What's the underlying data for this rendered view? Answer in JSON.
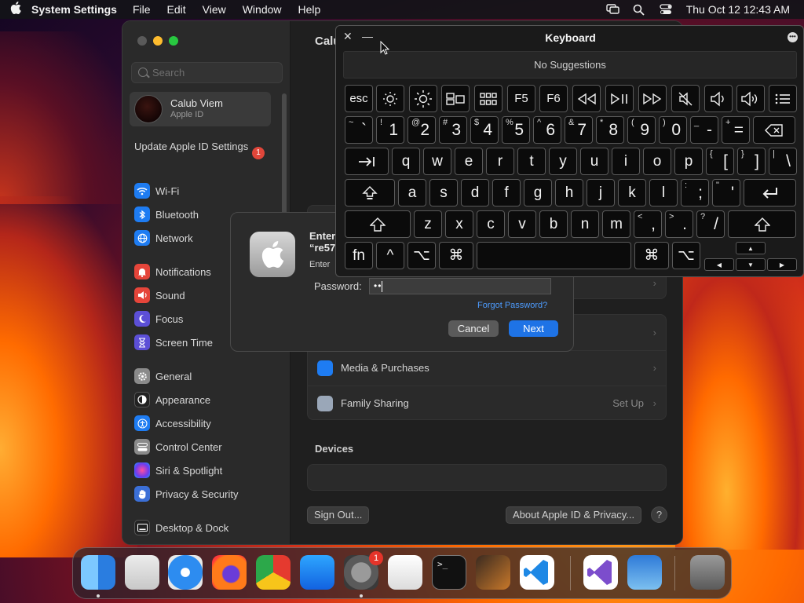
{
  "menubar": {
    "app_name": "System Settings",
    "menus": [
      "File",
      "Edit",
      "View",
      "Window",
      "Help"
    ],
    "clock": "Thu Oct 12  12:43 AM"
  },
  "sidebar": {
    "search_placeholder": "Search",
    "account": {
      "name": "Calub Viem",
      "subtitle": "Apple ID"
    },
    "update": {
      "label": "Update Apple ID Settings",
      "badge": "1"
    },
    "items": [
      {
        "label": "Wi-Fi",
        "icon": "wifi-icon",
        "color": "#1e7cf2"
      },
      {
        "label": "Bluetooth",
        "icon": "bluetooth-icon",
        "color": "#1e7cf2"
      },
      {
        "label": "Network",
        "icon": "globe-icon",
        "color": "#1e7cf2"
      },
      {
        "label": "Notifications",
        "icon": "bell-icon",
        "color": "#e5453a"
      },
      {
        "label": "Sound",
        "icon": "speaker-icon",
        "color": "#e5453a"
      },
      {
        "label": "Focus",
        "icon": "moon-icon",
        "color": "#5c4fd6"
      },
      {
        "label": "Screen Time",
        "icon": "hourglass-icon",
        "color": "#5c4fd6"
      },
      {
        "label": "General",
        "icon": "gear-icon",
        "color": "#8a8a8a"
      },
      {
        "label": "Appearance",
        "icon": "appearance-icon",
        "color": "#222222"
      },
      {
        "label": "Accessibility",
        "icon": "accessibility-icon",
        "color": "#1e7cf2"
      },
      {
        "label": "Control Center",
        "icon": "control-center-icon",
        "color": "#8a8a8a"
      },
      {
        "label": "Siri & Spotlight",
        "icon": "siri-icon",
        "color": "#b04ad8"
      },
      {
        "label": "Privacy & Security",
        "icon": "hand-icon",
        "color": "#3b6fd6"
      },
      {
        "label": "Desktop & Dock",
        "icon": "dock-icon",
        "color": "#222222"
      }
    ]
  },
  "content": {
    "title": "Calub Viem",
    "rows": [
      {
        "label": "Media & Purchases",
        "icon": "app-store-icon",
        "value": ""
      },
      {
        "label": "Family Sharing",
        "icon": "family-icon",
        "value": "Set Up"
      }
    ],
    "devices_title": "Devices",
    "sign_out": "Sign Out...",
    "about": "About Apple ID & Privacy...",
    "help": "?"
  },
  "dialog": {
    "title_line1": "Enter",
    "title_line2": "“re57",
    "subtitle": "Enter",
    "password_label": "Password:",
    "password_value": "••",
    "forgot": "Forgot Password?",
    "cancel": "Cancel",
    "next": "Next"
  },
  "keyboard": {
    "title": "Keyboard",
    "suggestions": "No Suggestions",
    "row_fn": [
      "esc",
      "brightness-down",
      "brightness-up",
      "mission-control",
      "launchpad",
      "F5",
      "F6",
      "rewind",
      "play-pause",
      "fast-forward",
      "mute",
      "volume-down",
      "volume-up",
      "list"
    ],
    "row_num": [
      {
        "shift": "~",
        "main": "`"
      },
      {
        "shift": "!",
        "main": "1"
      },
      {
        "shift": "@",
        "main": "2"
      },
      {
        "shift": "#",
        "main": "3"
      },
      {
        "shift": "$",
        "main": "4"
      },
      {
        "shift": "%",
        "main": "5"
      },
      {
        "shift": "^",
        "main": "6"
      },
      {
        "shift": "&",
        "main": "7"
      },
      {
        "shift": "*",
        "main": "8"
      },
      {
        "shift": "(",
        "main": "9"
      },
      {
        "shift": ")",
        "main": "0"
      },
      {
        "shift": "_",
        "main": "-"
      },
      {
        "shift": "+",
        "main": "="
      }
    ],
    "row_q": [
      "q",
      "w",
      "e",
      "r",
      "t",
      "y",
      "u",
      "i",
      "o",
      "p"
    ],
    "row_q_sym": [
      {
        "shift": "{",
        "main": "["
      },
      {
        "shift": "}",
        "main": "]"
      },
      {
        "shift": "|",
        "main": "\\"
      }
    ],
    "row_a": [
      "a",
      "s",
      "d",
      "f",
      "g",
      "h",
      "j",
      "k",
      "l"
    ],
    "row_a_sym": [
      {
        "shift": ":",
        "main": ";"
      },
      {
        "shift": "\"",
        "main": "'"
      }
    ],
    "row_z": [
      "z",
      "x",
      "c",
      "v",
      "b",
      "n",
      "m"
    ],
    "row_z_sym": [
      {
        "shift": "<",
        "main": ","
      },
      {
        "shift": ">",
        "main": "."
      },
      {
        "shift": "?",
        "main": "/"
      }
    ],
    "fn_label": "fn",
    "control_symbol": "^",
    "option_symbol": "⌥",
    "command_symbol": "⌘"
  },
  "dock": {
    "apps": [
      "Finder",
      "Launchpad",
      "Safari",
      "Firefox",
      "Chrome",
      "App Store",
      "System Settings",
      "TextEdit",
      "Terminal",
      "GarageBand",
      "VS Code",
      "Visual Studio",
      "Weather",
      "Trash"
    ],
    "settings_badge": "1"
  }
}
